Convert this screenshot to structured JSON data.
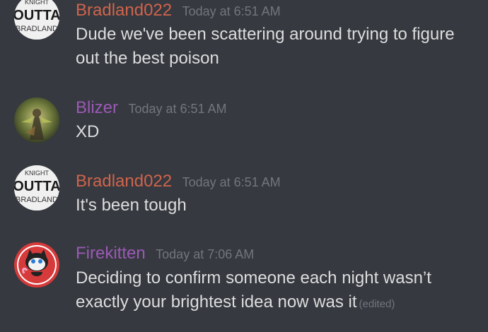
{
  "messages": [
    {
      "username": "Bradland022",
      "username_color": "#d0644c",
      "timestamp": "Today at 6:51 AM",
      "text": "Dude we've been scattering around trying to figure out the best poison",
      "edited": "",
      "avatar": {
        "kind": "text-logo",
        "line1": "KNIGHT",
        "line2": "OUTTA",
        "line3": "BRADLAND"
      }
    },
    {
      "username": "Blizer",
      "username_color": "#9b59b6",
      "timestamp": "Today at 6:51 AM",
      "text": "XD",
      "edited": "",
      "avatar": {
        "kind": "character-art"
      }
    },
    {
      "username": "Bradland022",
      "username_color": "#d0644c",
      "timestamp": "Today at 6:51 AM",
      "text": "It's been tough",
      "edited": "",
      "avatar": {
        "kind": "text-logo",
        "line1": "KNIGHT",
        "line2": "OUTTA",
        "line3": "BRADLAND"
      }
    },
    {
      "username": "Firekitten",
      "username_color": "#9b59b6",
      "timestamp": "Today at 7:06 AM",
      "text": "Deciding to confirm someone each night wasn’t exactly your brightest idea now was it",
      "edited": "(edited)",
      "avatar": {
        "kind": "cat-art"
      }
    }
  ]
}
